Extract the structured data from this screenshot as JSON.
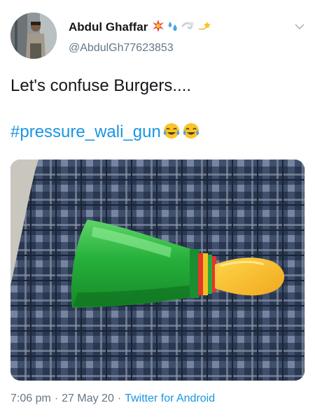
{
  "author": {
    "display_name": "Abdul Ghaffar",
    "handle": "@AbdulGh77623853",
    "name_emojis": [
      "sparkle-burst-emoji",
      "sweat-droplets-emoji",
      "dash-emoji",
      "dizzy-star-emoji"
    ]
  },
  "tweet": {
    "text": "Let's confuse Burgers....",
    "hashtag": "#pressure_wali_gun",
    "trailing_emojis": [
      "face-with-tears-of-joy-emoji",
      "face-with-tears-of-joy-emoji"
    ]
  },
  "media": {
    "description_icon": "bottle-toy-gun-photo"
  },
  "meta": {
    "time": "7:06 pm",
    "separator": "·",
    "date": "27 May 20",
    "source": "Twitter for Android"
  },
  "colors": {
    "link": "#1b95e0",
    "secondary_text": "#657786",
    "primary_text": "#14171a"
  }
}
